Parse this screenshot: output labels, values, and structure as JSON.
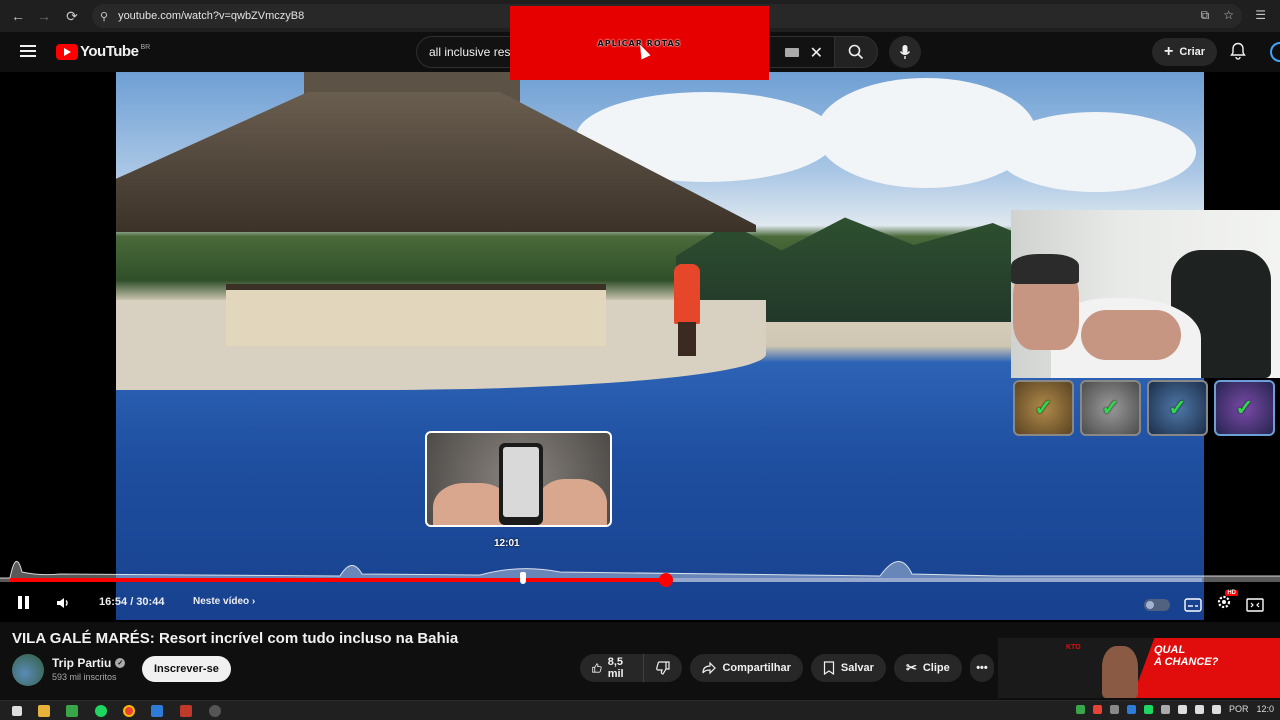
{
  "browser": {
    "url": "youtube.com/watch?v=qwbZVmczyB8"
  },
  "header": {
    "logo_text": "YouTube",
    "country": "BR",
    "search_value": "all inclusive  res",
    "create_label": "Criar"
  },
  "overlay": {
    "banner_text": "APLICAR ROTAS",
    "preview_time": "12:01"
  },
  "player": {
    "time_display": "16:54 / 30:44",
    "chapter_label": "Neste vídeo",
    "progress_fraction": 0.55,
    "hover_fraction": 0.43
  },
  "video": {
    "title": "VILA GALÉ MARÉS: Resort incrível com tudo incluso na Bahia"
  },
  "channel": {
    "name": "Trip Partiu",
    "subscribers": "593 mil inscritos",
    "subscribe_label": "Inscrever-se"
  },
  "actions": {
    "like_count": "8,5 mil",
    "share_label": "Compartilhar",
    "save_label": "Salvar",
    "clip_label": "Clipe"
  },
  "ad": {
    "brand": "KTO",
    "headline_1": "QUAL",
    "headline_2": "A CHANCE?"
  },
  "taskbar": {
    "language": "POR",
    "clock": "12:0"
  },
  "colors": {
    "accent_red": "#ff0000",
    "check_green": "#2fd84a"
  }
}
